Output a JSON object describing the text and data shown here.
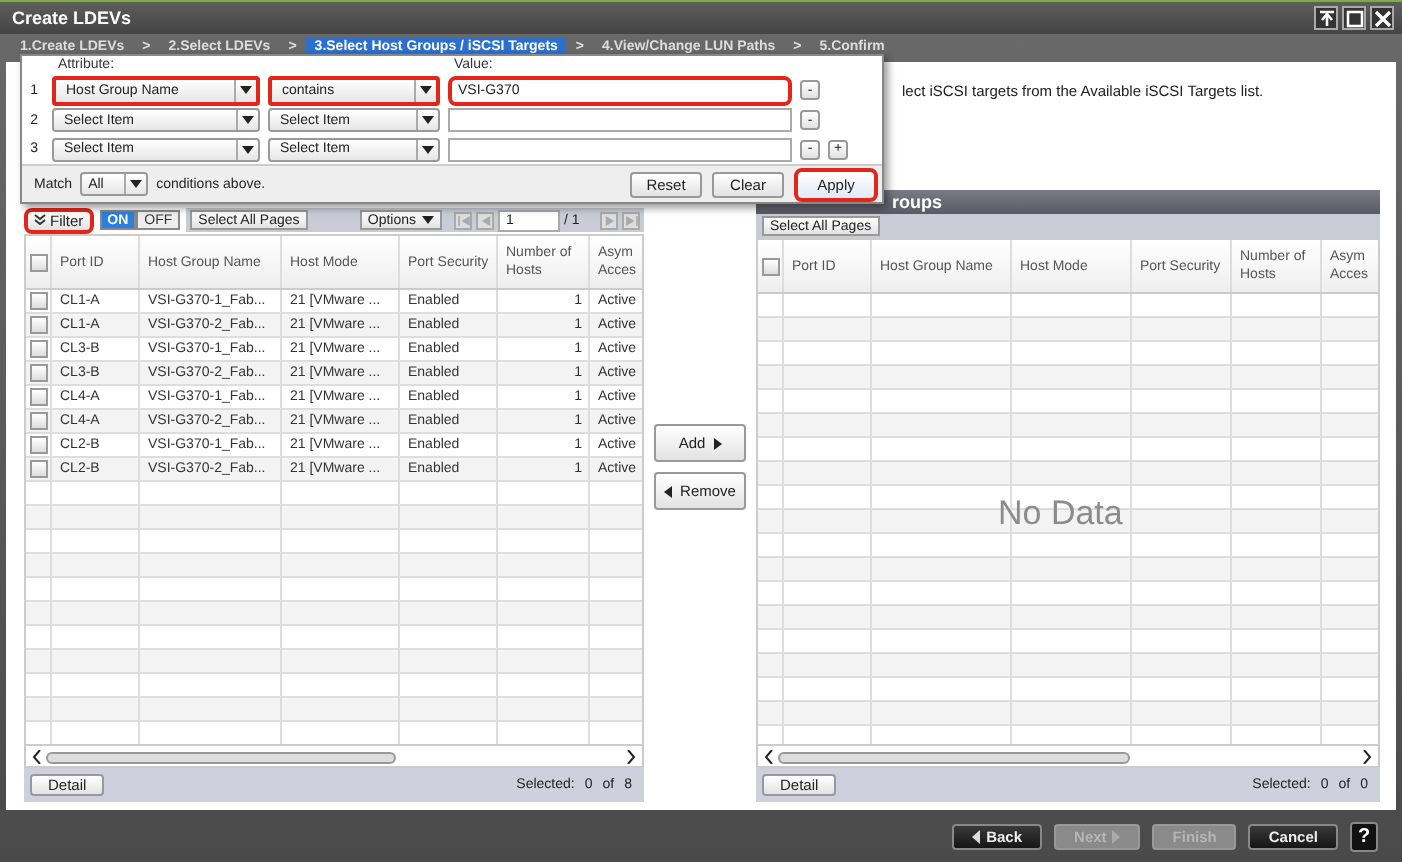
{
  "window": {
    "title": "Create LDEVs"
  },
  "steps": [
    {
      "kind": "step",
      "label": "1.Create LDEVs",
      "selected": false
    },
    {
      "kind": "separator",
      "label": ">"
    },
    {
      "kind": "step",
      "label": "2.Select LDEVs",
      "selected": false
    },
    {
      "kind": "separator",
      "label": ">"
    },
    {
      "kind": "step",
      "label": "3.Select Host Groups / iSCSI Targets",
      "selected": true
    },
    {
      "kind": "separator",
      "label": ">"
    },
    {
      "kind": "step",
      "label": "4.View/Change LUN Paths",
      "selected": false
    },
    {
      "kind": "separator",
      "label": ">"
    },
    {
      "kind": "step",
      "label": "5.Confirm",
      "selected": false
    }
  ],
  "instruction": "lect iSCSI targets from the Available iSCSI Targets list.",
  "filter_panel": {
    "attribute_label": "Attribute:",
    "value_label": "Value:",
    "conditions": [
      {
        "index": "1",
        "attribute": "Host Group Name",
        "operator": "contains",
        "value": "VSI-G370",
        "highlighted": true,
        "remove": "-"
      },
      {
        "index": "2",
        "attribute": "Select Item",
        "operator": "Select Item",
        "highlighted": false,
        "remove": "-"
      },
      {
        "index": "3",
        "attribute": "Select Item",
        "operator": "Select Item",
        "highlighted": false,
        "remove": "-",
        "add": "+"
      }
    ],
    "match_label": "Match",
    "match_value": "All",
    "match_suffix": "conditions above.",
    "buttons": [
      {
        "label": "Reset",
        "highlighted": false
      },
      {
        "label": "Clear",
        "highlighted": false
      },
      {
        "label": "Apply",
        "highlighted": true
      }
    ]
  },
  "available_panel": {
    "filter_button": {
      "label": "Filter",
      "highlighted": true
    },
    "filter_toggle": [
      {
        "label": "ON",
        "selected": true
      },
      {
        "label": "OFF",
        "selected": false
      }
    ],
    "select_all": "Select All Pages",
    "options": "Options",
    "page": "1",
    "page_total": "/ 1",
    "all_checked": false,
    "columns": [
      "Port ID",
      "Host Group Name",
      "Host Mode",
      "Port Security",
      "Number of Hosts",
      "Asym Acces"
    ],
    "rows": [
      {
        "checked": false,
        "cells": [
          "CL1-A",
          "VSI-G370-1_Fab...",
          "21 [VMware ...",
          "Enabled",
          "1",
          "Active"
        ]
      },
      {
        "checked": false,
        "cells": [
          "CL1-A",
          "VSI-G370-2_Fab...",
          "21 [VMware ...",
          "Enabled",
          "1",
          "Active"
        ]
      },
      {
        "checked": false,
        "cells": [
          "CL3-B",
          "VSI-G370-1_Fab...",
          "21 [VMware ...",
          "Enabled",
          "1",
          "Active"
        ]
      },
      {
        "checked": false,
        "cells": [
          "CL3-B",
          "VSI-G370-2_Fab...",
          "21 [VMware ...",
          "Enabled",
          "1",
          "Active"
        ]
      },
      {
        "checked": false,
        "cells": [
          "CL4-A",
          "VSI-G370-1_Fab...",
          "21 [VMware ...",
          "Enabled",
          "1",
          "Active"
        ]
      },
      {
        "checked": false,
        "cells": [
          "CL4-A",
          "VSI-G370-2_Fab...",
          "21 [VMware ...",
          "Enabled",
          "1",
          "Active"
        ]
      },
      {
        "checked": false,
        "cells": [
          "CL2-B",
          "VSI-G370-1_Fab...",
          "21 [VMware ...",
          "Enabled",
          "1",
          "Active"
        ]
      },
      {
        "checked": false,
        "cells": [
          "CL2-B",
          "VSI-G370-2_Fab...",
          "21 [VMware ...",
          "Enabled",
          "1",
          "Active"
        ]
      }
    ],
    "detail": "Detail",
    "selected_label": "Selected:",
    "selected_count": "0",
    "of_label": "of",
    "total": "8"
  },
  "add_button": "Add",
  "remove_button": "Remove",
  "selected_panel": {
    "title": "roups",
    "select_all": "Select All Pages",
    "all_checked": false,
    "columns": [
      "Port ID",
      "Host Group Name",
      "Host Mode",
      "Port Security",
      "Number of Hosts",
      "Asym Acces"
    ],
    "empty_text": "No Data",
    "detail": "Detail",
    "selected_label": "Selected:",
    "selected_count": "0",
    "of_label": "of",
    "total": "0"
  },
  "footer_buttons": [
    {
      "label": "Back",
      "disabled": false
    },
    {
      "label": "Next",
      "disabled": true
    },
    {
      "label": "Finish",
      "disabled": true
    },
    {
      "label": "Cancel",
      "disabled": false
    }
  ],
  "help": "?"
}
